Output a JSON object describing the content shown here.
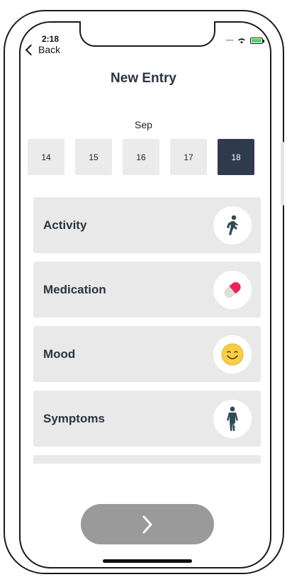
{
  "status_bar": {
    "time": "2:18",
    "back_label": "Back"
  },
  "header": {
    "title": "New Entry"
  },
  "calendar": {
    "month": "Sep",
    "days": [
      "14",
      "15",
      "16",
      "17",
      "18"
    ],
    "selected_day": "18"
  },
  "entries": [
    {
      "label": "Activity",
      "icon": "person-walking-icon"
    },
    {
      "label": "Medication",
      "icon": "pill-icon"
    },
    {
      "label": "Mood",
      "icon": "smiley-face-icon"
    },
    {
      "label": "Symptoms",
      "icon": "body-symptoms-icon"
    }
  ],
  "next_button": {
    "icon": "chevron-right-icon"
  },
  "colors": {
    "selected_date_bg": "#2f3a4d",
    "card_bg": "#e9e9e9",
    "next_button_bg": "#9a9a9a",
    "activity_icon": "#2f4a50",
    "pill_red": "#e8245a",
    "mood_yellow": "#f6cf45"
  }
}
